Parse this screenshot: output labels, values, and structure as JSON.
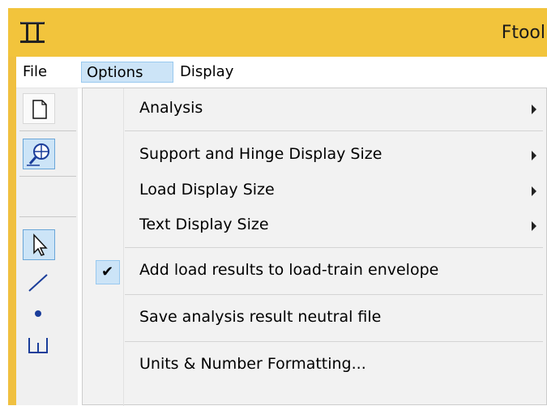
{
  "window": {
    "title": "Ftool"
  },
  "menubar": {
    "file": "File",
    "options": "Options",
    "display": "Display"
  },
  "toolbar": {
    "icons": [
      "new-document-icon",
      "grid-zoom-icon",
      "select-arrow-icon",
      "line-icon",
      "node-icon",
      "support-icon"
    ]
  },
  "dropdown": {
    "items": [
      {
        "label": "Analysis",
        "submenu": true
      },
      {
        "label": "Support and Hinge Display Size",
        "submenu": true
      },
      {
        "label": "Load Display Size",
        "submenu": true
      },
      {
        "label": "Text Display Size",
        "submenu": true
      },
      {
        "label": "Add load results to load-train envelope",
        "checked": true
      },
      {
        "label": "Save analysis result neutral file"
      },
      {
        "label": "Units & Number Formatting..."
      }
    ]
  },
  "colors": {
    "title_bar": "#f2c43c",
    "menu_highlight": "#cce4f7",
    "menu_background": "#f2f2f2"
  }
}
